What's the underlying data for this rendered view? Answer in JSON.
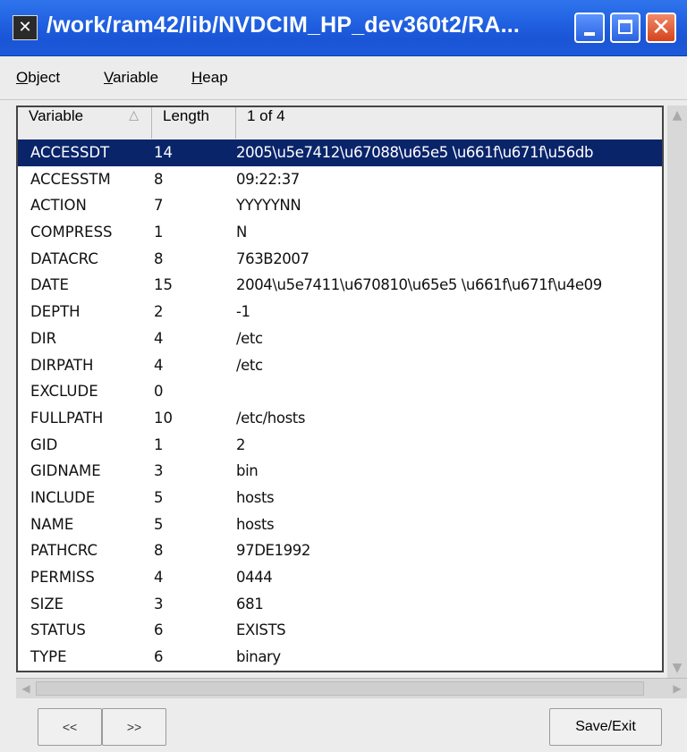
{
  "window": {
    "title": "/work/ram42/lib/NVDCIM_HP_dev360t2/RA...",
    "app_icon": "x-icon",
    "colors": {
      "titlebar": "#1f5fe0",
      "selection": "#0a246a"
    }
  },
  "menu": {
    "items": [
      {
        "ul": "O",
        "rest": "bject"
      },
      {
        "ul": "V",
        "rest": "ariable"
      },
      {
        "ul": "H",
        "rest": "eap"
      }
    ]
  },
  "table": {
    "headers": {
      "variable": "Variable",
      "length": "Length",
      "value": "1 of 4"
    },
    "sort_icon": "△",
    "selected_row": 0,
    "rows": [
      {
        "variable": "ACCESSDT",
        "length": "14",
        "value": "2005\\u5e7412\\u67088\\u65e5 \\u661f\\u671f\\u56db"
      },
      {
        "variable": "ACCESSTM",
        "length": "8",
        "value": "09:22:37"
      },
      {
        "variable": "ACTION",
        "length": "7",
        "value": "YYYYYNN"
      },
      {
        "variable": "COMPRESS",
        "length": "1",
        "value": "N"
      },
      {
        "variable": "DATACRC",
        "length": "8",
        "value": "763B2007"
      },
      {
        "variable": "DATE",
        "length": "15",
        "value": "2004\\u5e7411\\u670810\\u65e5 \\u661f\\u671f\\u4e09"
      },
      {
        "variable": "DEPTH",
        "length": "2",
        "value": "-1"
      },
      {
        "variable": "DIR",
        "length": "4",
        "value": "/etc"
      },
      {
        "variable": "DIRPATH",
        "length": "4",
        "value": "/etc"
      },
      {
        "variable": "EXCLUDE",
        "length": "0",
        "value": ""
      },
      {
        "variable": "FULLPATH",
        "length": "10",
        "value": "/etc/hosts"
      },
      {
        "variable": "GID",
        "length": "1",
        "value": "2"
      },
      {
        "variable": "GIDNAME",
        "length": "3",
        "value": "bin"
      },
      {
        "variable": "INCLUDE",
        "length": "5",
        "value": "hosts"
      },
      {
        "variable": "NAME",
        "length": "5",
        "value": "hosts"
      },
      {
        "variable": "PATHCRC",
        "length": "8",
        "value": "97DE1992"
      },
      {
        "variable": "PERMISS",
        "length": "4",
        "value": "0444"
      },
      {
        "variable": "SIZE",
        "length": "3",
        "value": "681"
      },
      {
        "variable": "STATUS",
        "length": "6",
        "value": "EXISTS"
      },
      {
        "variable": "TYPE",
        "length": "6",
        "value": "binary"
      }
    ]
  },
  "buttons": {
    "prev": "<<",
    "next": ">>",
    "save": "Save/Exit"
  }
}
